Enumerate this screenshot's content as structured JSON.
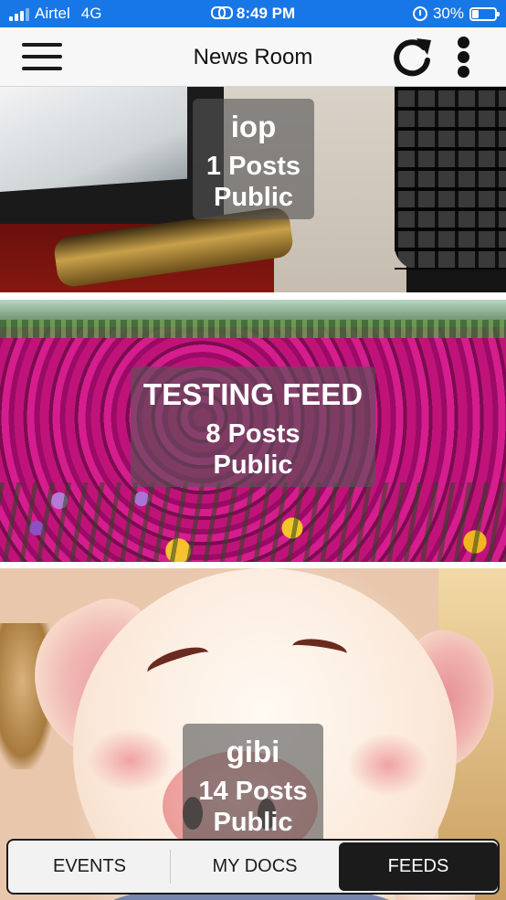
{
  "status_bar": {
    "carrier": "Airtel",
    "network": "4G",
    "time": "8:49 PM",
    "battery": "30%",
    "battery_level": 0.3,
    "icons": [
      "signal-icon",
      "link-icon",
      "alarm-icon",
      "battery-icon"
    ]
  },
  "header": {
    "title": "News Room",
    "menu_icon": "hamburger-menu-icon",
    "refresh_icon": "refresh-icon",
    "more_icon": "more-vertical-icon"
  },
  "feeds": [
    {
      "name": "iop",
      "posts": "1 Posts",
      "visibility": "Public"
    },
    {
      "name": "TESTING FEED",
      "posts": "8 Posts",
      "visibility": "Public"
    },
    {
      "name": "gibi",
      "posts": "14 Posts",
      "visibility": "Public"
    }
  ],
  "tabs": {
    "items": [
      {
        "label": "EVENTS"
      },
      {
        "label": "MY DOCS"
      },
      {
        "label": "FEEDS"
      }
    ],
    "selected": "FEEDS"
  },
  "colors": {
    "status_bar": "#1877e6",
    "header_bg": "#f7f7f7",
    "overlay": "rgba(85,85,85,0.62)",
    "active_tab": "#1b1b1b"
  }
}
